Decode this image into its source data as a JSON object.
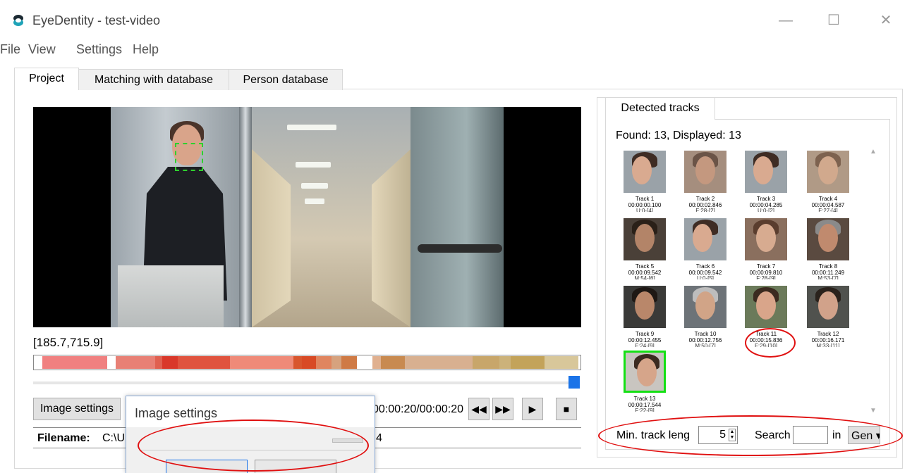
{
  "window": {
    "title": "EyeDentity - test-video",
    "minimize_icon": "minimize-icon",
    "maximize_icon": "maximize-icon",
    "close_icon": "close-icon",
    "minimize": "—",
    "maximize": "☐",
    "close": "✕"
  },
  "menu": [
    "File",
    "View",
    "Settings",
    "Help"
  ],
  "tabs": [
    "Project",
    "Matching with database",
    "Person database"
  ],
  "video": {
    "coords": "[185.7,715.9]",
    "time": "00:00:20/00:00:20"
  },
  "controls": {
    "image_settings": "Image settings",
    "rewind": "◀◀",
    "forward": "▶▶",
    "play": "▶",
    "stop": "■"
  },
  "filename": {
    "label": "Filename:",
    "value": "C:\\U",
    "tail": "4"
  },
  "dialog": {
    "title": "Image settings"
  },
  "tracks_panel": {
    "tab": "Detected tracks",
    "found": "Found: 13, Displayed: 13",
    "tracks": [
      {
        "name": "Track 1",
        "time": "00:00:00.100",
        "extra": "U:0-[4]"
      },
      {
        "name": "Track 2",
        "time": "00:00:02.846",
        "extra": "F:28-[2]"
      },
      {
        "name": "Track 3",
        "time": "00:00:04.285",
        "extra": "U:0-[2]"
      },
      {
        "name": "Track 4",
        "time": "00:00:04.587",
        "extra": "F:27-[4]"
      },
      {
        "name": "Track 5",
        "time": "00:00:09.542",
        "extra": "M:54-[6]"
      },
      {
        "name": "Track 6",
        "time": "00:00:09.542",
        "extra": "U:0-[5]"
      },
      {
        "name": "Track 7",
        "time": "00:00:09.810",
        "extra": "F:28-[9]"
      },
      {
        "name": "Track 8",
        "time": "00:00:11.249",
        "extra": "M:53-[7]"
      },
      {
        "name": "Track 9",
        "time": "00:00:12.455",
        "extra": "F:24-[9]"
      },
      {
        "name": "Track 10",
        "time": "00:00:12.756",
        "extra": "M:50-[7]"
      },
      {
        "name": "Track 11",
        "time": "00:00:15.836",
        "extra": "F:29-[10]"
      },
      {
        "name": "Track 12",
        "time": "00:00:16.171",
        "extra": "M:33-[11]"
      },
      {
        "name": "Track 13",
        "time": "00:00:17.544",
        "extra": "F:22-[9]"
      }
    ],
    "min_track_label": "Min. track leng",
    "min_track_value": "5",
    "search_label": "Search",
    "in_label": "in",
    "gender_value": "Gen",
    "gender_arrow": "▾",
    "spin_up": "▲",
    "spin_down": "▼",
    "scroll_up": "▲",
    "scroll_down": "▼"
  },
  "colors": {
    "accent": "#1a73e8",
    "selected_track": "#14e014",
    "annotation": "#e01010",
    "face_box": "#2ed12e"
  }
}
